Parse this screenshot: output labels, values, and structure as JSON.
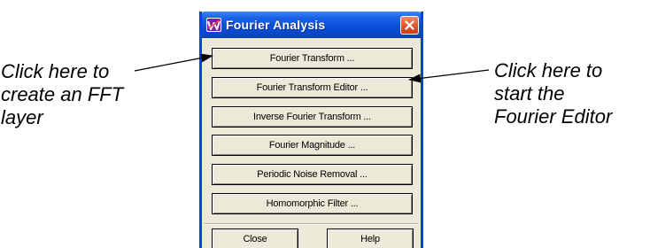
{
  "window": {
    "title": "Fourier Analysis",
    "buttons": [
      {
        "label": "Fourier Transform ..."
      },
      {
        "label": "Fourier Transform Editor ..."
      },
      {
        "label": "Inverse Fourier Transform ..."
      },
      {
        "label": "Fourier Magnitude ..."
      },
      {
        "label": "Periodic Noise Removal ..."
      },
      {
        "label": "Homomorphic Filter ..."
      }
    ],
    "close_label": "Close",
    "help_label": "Help"
  },
  "annotations": {
    "left": [
      "Click here to",
      "create an FFT",
      "layer"
    ],
    "right": [
      "Click here to",
      "start the",
      "Fourier Editor"
    ]
  },
  "icons": {
    "app": "app-icon",
    "close": "close-icon"
  },
  "colors": {
    "titlebar": "#0a50d8",
    "close_button": "#e05a30",
    "window_body": "#ece9d8"
  }
}
